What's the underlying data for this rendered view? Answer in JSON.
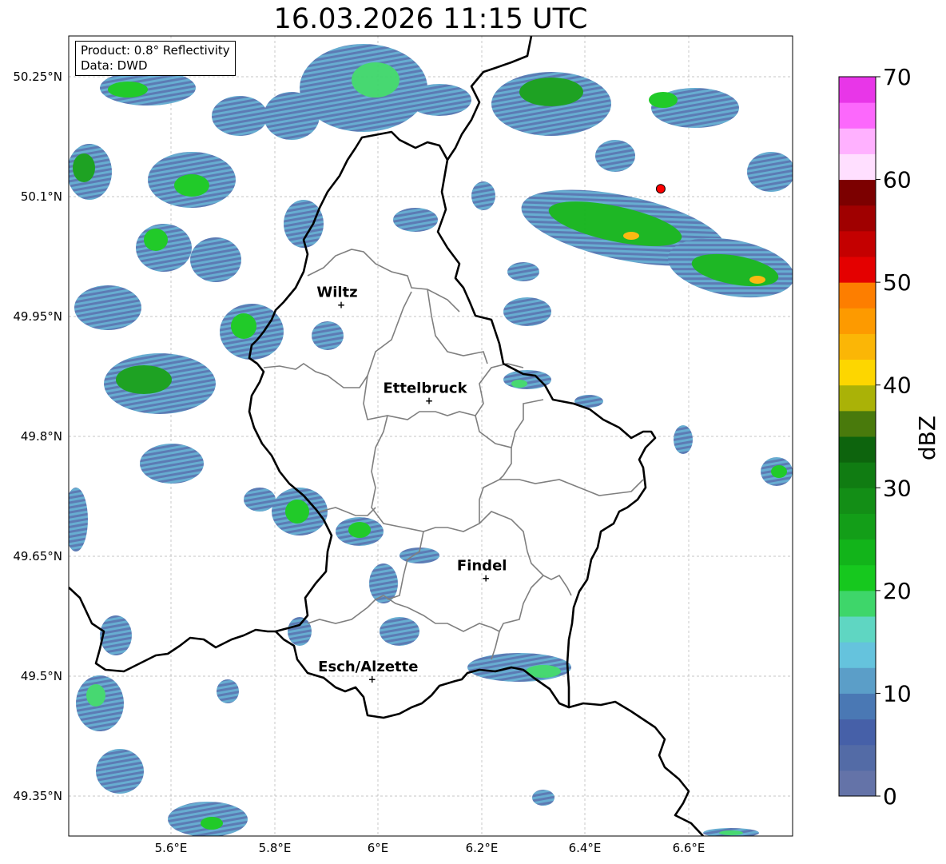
{
  "title": "16.03.2026 11:15 UTC",
  "info_box": {
    "product": "Product: 0.8° Reflectivity",
    "data": "Data: DWD"
  },
  "map": {
    "lon_range": [
      5.4,
      6.8
    ],
    "lat_range": [
      49.3,
      50.3
    ],
    "lat_ticks": [
      "50.25°N",
      "50.1°N",
      "49.95°N",
      "49.8°N",
      "49.65°N",
      "49.5°N",
      "49.35°N"
    ],
    "lat_values": [
      50.25,
      50.1,
      49.95,
      49.8,
      49.65,
      49.5,
      49.35
    ],
    "lon_ticks": [
      "5.6°E",
      "5.8°E",
      "6°E",
      "6.2°E",
      "6.4°E",
      "6.6°E"
    ],
    "lon_values": [
      5.6,
      5.8,
      6.0,
      6.2,
      6.4,
      6.6
    ],
    "grid": true
  },
  "cities": [
    {
      "name": "Wiltz",
      "lon": 5.93,
      "lat": 49.965
    },
    {
      "name": "Ettelbruck",
      "lon": 6.1,
      "lat": 49.845
    },
    {
      "name": "Findel",
      "lon": 6.21,
      "lat": 49.623
    },
    {
      "name": "Esch/Alzette",
      "lon": 5.99,
      "lat": 49.497
    }
  ],
  "radar_site": {
    "lon": 6.548,
    "lat": 50.11,
    "color": "#ff0000"
  },
  "colorbar": {
    "label": "dBZ",
    "min": 0,
    "max": 70,
    "ticks": [
      "0",
      "10",
      "20",
      "30",
      "40",
      "50",
      "60",
      "70"
    ],
    "colors": [
      "#6473a8",
      "#536ba6",
      "#4660a8",
      "#4a78b4",
      "#5b9ec8",
      "#65c3dd",
      "#5fd6c2",
      "#3ed66a",
      "#16c81e",
      "#12b41a",
      "#139e18",
      "#138e16",
      "#107c12",
      "#0d640d",
      "#497a0c",
      "#aab207",
      "#fdd600",
      "#fbb606",
      "#fd9a00",
      "#fd7e00",
      "#e40000",
      "#c40000",
      "#a00000",
      "#7c0000",
      "#ffdfff",
      "#ffb1ff",
      "#fc68fc",
      "#e836e8"
    ]
  }
}
